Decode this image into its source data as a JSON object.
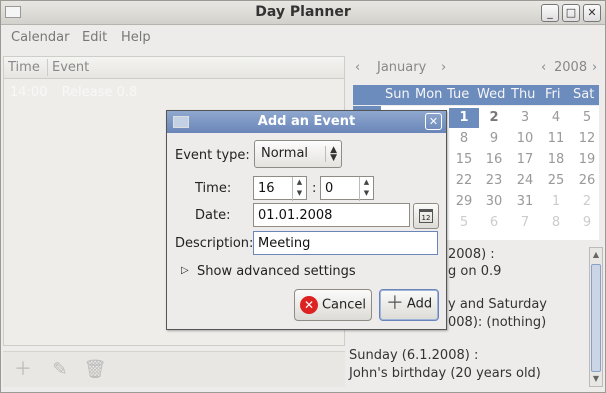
{
  "window": {
    "title": "Day Planner",
    "min": "_",
    "max": "□",
    "close": "✕"
  },
  "menu": [
    "Calendar",
    "Edit",
    "Help"
  ],
  "events": {
    "headers": [
      "Time",
      "Event"
    ],
    "rows": [
      {
        "time": "14:00",
        "event": "Release 0.8"
      }
    ]
  },
  "calendar": {
    "month": "January",
    "year": "2008",
    "prev": "‹",
    "next": "›",
    "weekdays": [
      "Sun",
      "Mon",
      "Tue",
      "Wed",
      "Thu",
      "Fri",
      "Sat"
    ],
    "rows": [
      [
        "",
        "",
        "1",
        "2",
        "3",
        "4",
        "5"
      ],
      [
        "",
        "8",
        "9",
        "10",
        "11",
        "12"
      ],
      [
        "15",
        "16",
        "17",
        "18",
        "19"
      ],
      [
        "",
        "22",
        "23",
        "24",
        "25",
        "26"
      ],
      [
        "",
        "29",
        "30",
        "31",
        "1",
        "2"
      ],
      [
        "",
        "5",
        "6",
        "7",
        "8",
        "9"
      ]
    ]
  },
  "notes": {
    "lines": [
      "2008) :",
      "g on 0.9",
      "y and Saturday",
      "008): (nothing)",
      "Sunday (6.1.2008) :",
      "John's birthday (20 years old)"
    ]
  },
  "dialog": {
    "title": "Add an Event",
    "event_type_label": "Event type:",
    "event_type_value": "Normal",
    "time_label": "Time:",
    "hour": "16",
    "minute": "0",
    "time_sep": ":",
    "date_label": "Date:",
    "date_value": "01.01.2008",
    "cal_icon_text": "12",
    "description_label": "Description:",
    "description_value": "Meeting",
    "advanced_label": "Show advanced settings",
    "cancel_label": "Cancel",
    "add_label": "Add"
  }
}
